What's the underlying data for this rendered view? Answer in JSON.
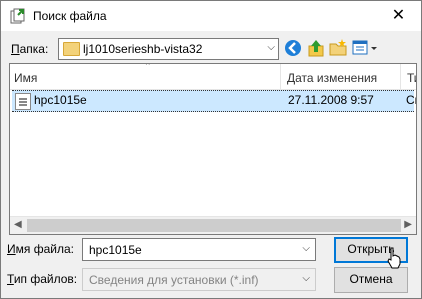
{
  "window": {
    "title": "Поиск файла",
    "close_glyph": "✕"
  },
  "folder": {
    "label": "Папка:",
    "label_hotkey": "П",
    "label_rest": "апка:",
    "value": "lj1010serieshb-vista32"
  },
  "toolbar": {
    "icons": [
      "back-icon",
      "up-folder-icon",
      "new-folder-icon",
      "view-menu-icon"
    ]
  },
  "list": {
    "columns": [
      "Имя",
      "Дата изменения",
      "Ти"
    ],
    "rows": [
      {
        "name": "hpc1015e",
        "date": "27.11.2008 9:57",
        "type": "Св"
      }
    ]
  },
  "filename": {
    "label_hotkey": "И",
    "label_rest": "мя файла:",
    "value": "hpc1015e"
  },
  "filetype": {
    "label_hotkey": "Т",
    "label_rest": "ип файлов:",
    "value": "Сведения для установки (*.inf)"
  },
  "buttons": {
    "open": "Открыть",
    "cancel": "Отмена"
  },
  "colors": {
    "selection": "#cce8ff",
    "accent": "#0078d7"
  }
}
